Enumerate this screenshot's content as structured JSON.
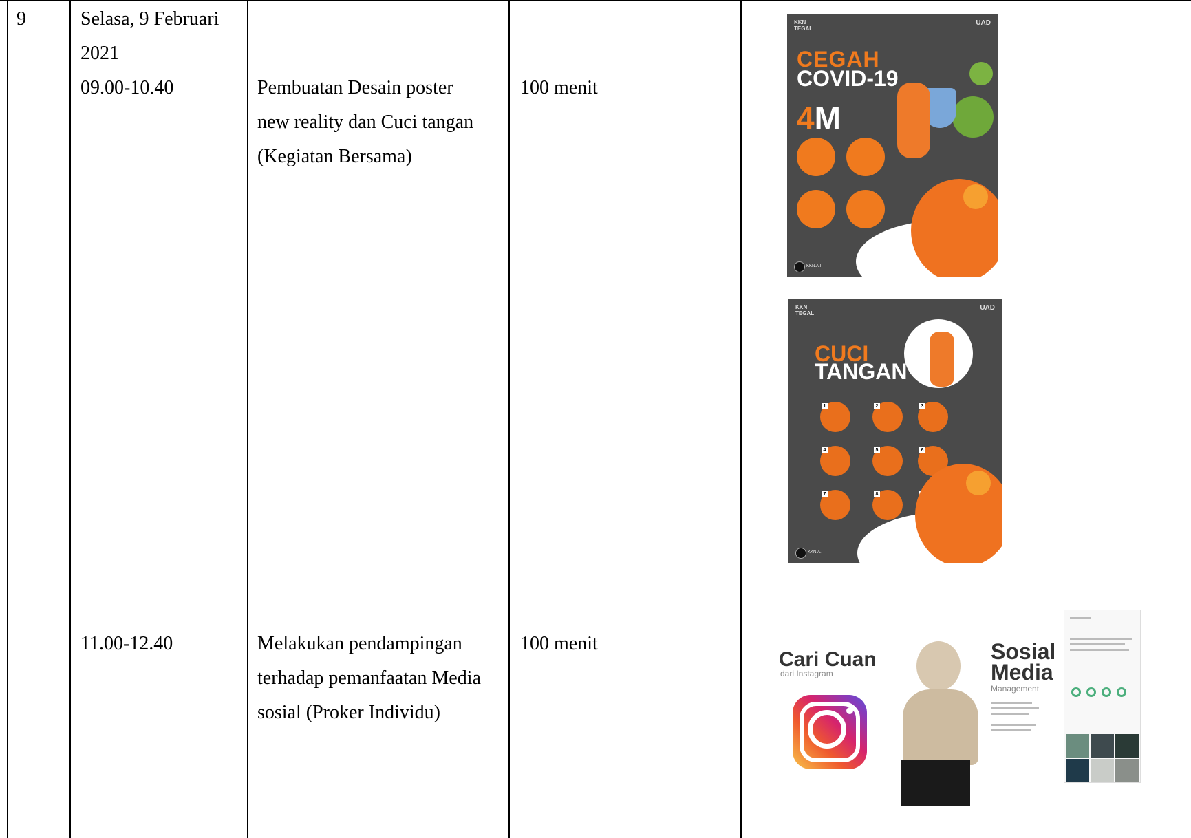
{
  "row": {
    "no": "9",
    "date_line1": "Selasa, 9 Februari",
    "date_line2": "2021",
    "sessions": [
      {
        "time": "09.00-10.40",
        "activity": [
          "Pembuatan Desain poster",
          "new reality dan Cuci tangan",
          "(Kegiatan Bersama)"
        ],
        "duration": "100 menit"
      },
      {
        "time": "11.00-12.40",
        "activity": [
          "Melakukan pendampingan",
          "terhadap pemanfaatan Media",
          "sosial (Proker Individu)"
        ],
        "duration": "100 menit"
      }
    ]
  },
  "poster1": {
    "org": "KKN\nTEGAL",
    "uad": "UAD",
    "line1": "CEGAH",
    "line2": "COVID-19",
    "big_num": "4",
    "big_letter": "M",
    "logo_text": "KKN.A.I"
  },
  "poster2": {
    "org": "KKN\nTEGAL",
    "uad": "UAD",
    "line1": "CUCI",
    "line2": "TANGAN",
    "logo_text": "KKN.A.I"
  },
  "poster3": {
    "title1": "Cari Cuan",
    "title1_sub": "dari Instagram",
    "title2_line1": "Sosial",
    "title2_line2": "Media",
    "title2_sub": "Management"
  },
  "colors": {
    "poster_bg": "#4a4a4a",
    "accent": "#f07a1e"
  }
}
